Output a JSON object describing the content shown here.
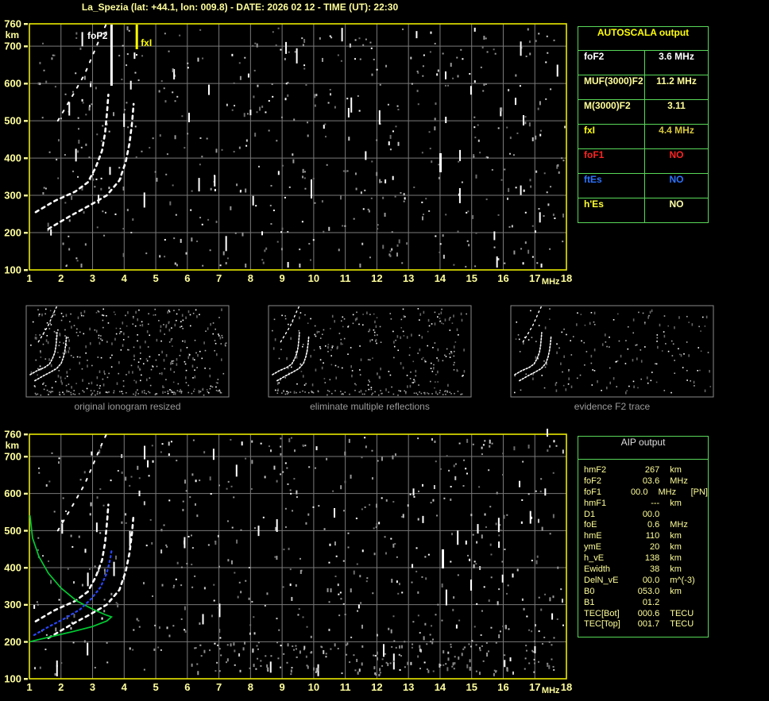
{
  "title": "La_Spezia (lat: +44.1, lon: 009.8) - DATE: 2026 02 12 - TIME (UT): 22:30",
  "colors": {
    "border_yellow": "#e9e900",
    "label_yellow": "#ffff9c",
    "grid_gray": "#7a7a7a",
    "table_green": "#58d858",
    "trace_white": "#ffffff",
    "profile_green": "#00cc33",
    "model_blue": "#2946ff",
    "caption_gray": "#9a9a9a",
    "foF2_marker": "#ffffff",
    "fxI_marker": "#ffff00"
  },
  "plots": {
    "y_unit": "km",
    "x_unit": "MHz",
    "y_ticks": [
      760,
      700,
      600,
      500,
      400,
      300,
      200,
      100
    ],
    "x_ticks": [
      1,
      2,
      3,
      4,
      5,
      6,
      7,
      8,
      9,
      10,
      11,
      12,
      13,
      14,
      15,
      16,
      17,
      18
    ],
    "foF2_marker_label": "foF2",
    "fxI_marker_label": "fxI"
  },
  "autoscala": {
    "title": "AUTOSCALA output",
    "rows": [
      {
        "param": "foF2",
        "value": "3.6 MHz",
        "param_color": "#ffffff",
        "value_color": "#ffffff"
      },
      {
        "param": "MUF(3000)F2",
        "value": "11.2 MHz",
        "param_color": "#ffff99",
        "value_color": "#ffff99"
      },
      {
        "param": "M(3000)F2",
        "value": "3.11",
        "param_color": "#ffff99",
        "value_color": "#ffff99"
      },
      {
        "param": "fxI",
        "value": "4.4 MHz",
        "param_color": "#ffff00",
        "value_color": "#d8c83c"
      },
      {
        "param": "foF1",
        "value": "NO",
        "param_color": "#ff2222",
        "value_color": "#ff2222"
      },
      {
        "param": "ftEs",
        "value": "NO",
        "param_color": "#2d72ff",
        "value_color": "#2d72ff"
      },
      {
        "param": "h'Es",
        "value": "NO",
        "param_color": "#ffff33",
        "value_color": "#ffffaa"
      }
    ]
  },
  "thumbnails": [
    {
      "caption": "original ionogram resized"
    },
    {
      "caption": "eliminate multiple reflections"
    },
    {
      "caption": "evidence F2 trace"
    }
  ],
  "aip": {
    "title": "AIP output",
    "rows": [
      {
        "param": "hmF2",
        "value": "267",
        "unit": "km",
        "extra": ""
      },
      {
        "param": "foF2",
        "value": "03.6",
        "unit": "MHz",
        "extra": ""
      },
      {
        "param": "foF1",
        "value": "00.0",
        "unit": "MHz",
        "extra": "[PN]"
      },
      {
        "param": "hmF1",
        "value": "---",
        "unit": "km",
        "extra": ""
      },
      {
        "param": "D1",
        "value": "00.0",
        "unit": "",
        "extra": ""
      },
      {
        "param": "foE",
        "value": "0.6",
        "unit": "MHz",
        "extra": ""
      },
      {
        "param": "hmE",
        "value": "110",
        "unit": "km",
        "extra": ""
      },
      {
        "param": "ymE",
        "value": "20",
        "unit": "km",
        "extra": ""
      },
      {
        "param": "h_vE",
        "value": "138",
        "unit": "km",
        "extra": ""
      },
      {
        "param": "Ewidth",
        "value": "38",
        "unit": "km",
        "extra": ""
      },
      {
        "param": "DelN_vE",
        "value": "00.0",
        "unit": "m^(-3)",
        "extra": ""
      },
      {
        "param": "B0",
        "value": "053.0",
        "unit": "km",
        "extra": ""
      },
      {
        "param": "B1",
        "value": "01.2",
        "unit": "",
        "extra": ""
      },
      {
        "param": "TEC[Bot]",
        "value": "000.6",
        "unit": "TECU",
        "extra": ""
      },
      {
        "param": "TEC[Top]",
        "value": "001.7",
        "unit": "TECU",
        "extra": ""
      }
    ]
  },
  "chart_data": {
    "type": "scatter",
    "title": "Ionogram - virtual height vs sounding frequency",
    "xlabel": "MHz",
    "ylabel": "km",
    "xlim": [
      1,
      18
    ],
    "ylim": [
      100,
      760
    ],
    "grid": true,
    "markers": {
      "foF2_MHz": 3.6,
      "fxI_MHz": 4.4,
      "MUF3000F2_MHz": 11.2,
      "M3000F2": 3.11
    },
    "traces": {
      "o_trace": [
        [
          1.2,
          255
        ],
        [
          1.8,
          285
        ],
        [
          2.45,
          310
        ],
        [
          2.85,
          335
        ],
        [
          3.1,
          375
        ],
        [
          3.3,
          420
        ],
        [
          3.4,
          470
        ],
        [
          3.46,
          525
        ],
        [
          3.5,
          570
        ]
      ],
      "x_trace": [
        [
          1.6,
          210
        ],
        [
          2.3,
          245
        ],
        [
          2.95,
          275
        ],
        [
          3.45,
          300
        ],
        [
          3.85,
          340
        ],
        [
          4.05,
          390
        ],
        [
          4.17,
          440
        ],
        [
          4.25,
          495
        ],
        [
          4.3,
          545
        ]
      ],
      "second_hop": [
        [
          1.9,
          500
        ],
        [
          2.35,
          565
        ],
        [
          2.75,
          625
        ],
        [
          3.05,
          685
        ],
        [
          3.3,
          735
        ],
        [
          3.45,
          762
        ]
      ],
      "profile": [
        [
          1.02,
          540
        ],
        [
          1.1,
          480
        ],
        [
          1.3,
          430
        ],
        [
          1.6,
          385
        ],
        [
          2.0,
          345
        ],
        [
          2.5,
          310
        ],
        [
          3.0,
          288
        ],
        [
          3.4,
          273
        ],
        [
          3.6,
          267
        ],
        [
          3.45,
          256
        ],
        [
          3.0,
          241
        ],
        [
          2.4,
          228
        ],
        [
          1.8,
          216
        ],
        [
          1.3,
          206
        ],
        [
          1.02,
          200
        ]
      ],
      "model": [
        [
          1.15,
          218
        ],
        [
          1.6,
          240
        ],
        [
          2.1,
          262
        ],
        [
          2.6,
          287
        ],
        [
          2.95,
          315
        ],
        [
          3.25,
          347
        ],
        [
          3.45,
          385
        ],
        [
          3.55,
          420
        ],
        [
          3.6,
          445
        ]
      ]
    }
  }
}
